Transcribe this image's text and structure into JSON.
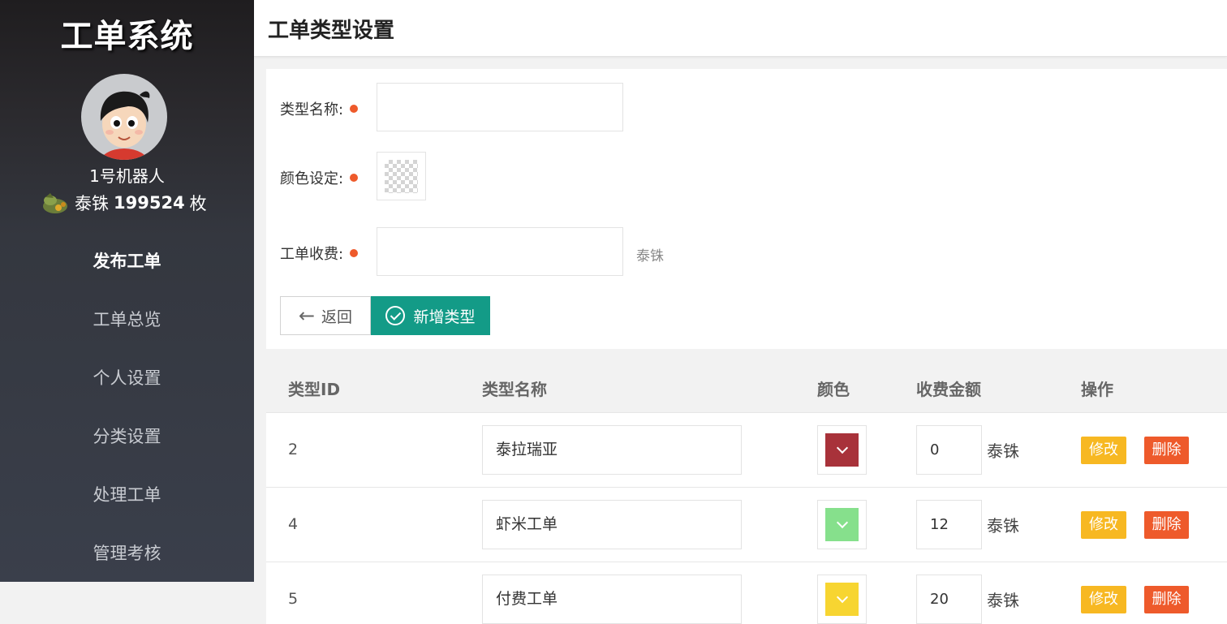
{
  "sidebar": {
    "brand": "工单系统",
    "username": "1号机器人",
    "coin": {
      "name": "泰铢",
      "amount": "199524",
      "suffix": "枚",
      "icon": "coin-pouch-icon"
    },
    "nav": [
      {
        "label": "发布工单",
        "active": true
      },
      {
        "label": "工单总览",
        "active": false
      },
      {
        "label": "个人设置",
        "active": false
      },
      {
        "label": "分类设置",
        "active": false
      },
      {
        "label": "处理工单",
        "active": false
      },
      {
        "label": "管理考核",
        "active": false
      }
    ]
  },
  "header": {
    "title": "工单类型设置"
  },
  "form": {
    "name_label": "类型名称:",
    "name_value": "",
    "color_label": "颜色设定:",
    "fee_label": "工单收费:",
    "fee_value": "",
    "fee_unit": "泰铢",
    "back_button": "返回",
    "add_button": "新增类型"
  },
  "table": {
    "headers": [
      "类型ID",
      "类型名称",
      "颜色",
      "收费金额",
      "操作"
    ],
    "rows": [
      {
        "id": "2",
        "name": "泰拉瑞亚",
        "color": "#a8323a",
        "fee": "0",
        "unit": "泰铢",
        "edit": "修改",
        "delete": "删除"
      },
      {
        "id": "4",
        "name": "虾米工单",
        "color": "#86e08c",
        "fee": "12",
        "unit": "泰铢",
        "edit": "修改",
        "delete": "删除"
      },
      {
        "id": "5",
        "name": "付费工单",
        "color": "#f7d531",
        "fee": "20",
        "unit": "泰铢",
        "edit": "修改",
        "delete": "删除"
      }
    ]
  },
  "colors": {
    "sidebar_top": "#1f1d1f",
    "sidebar_bottom": "#3a3f4b",
    "primary": "#139b87",
    "edit": "#f7b822",
    "danger": "#ee5a2b",
    "required_dot": "#ee5a2b"
  }
}
